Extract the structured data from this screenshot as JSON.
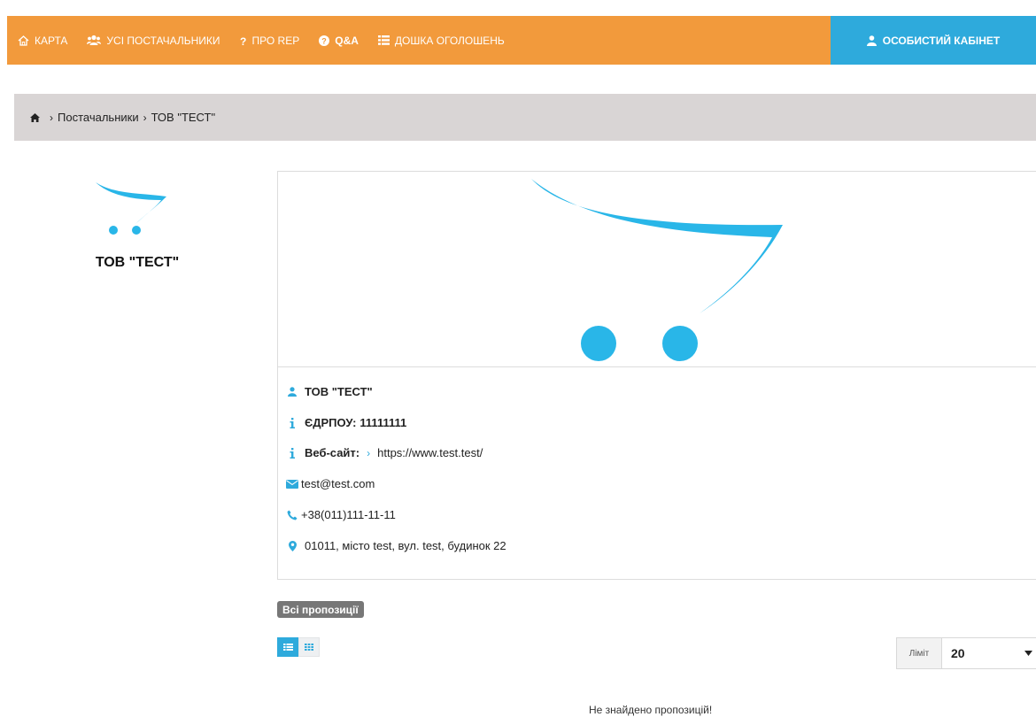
{
  "nav": {
    "items": [
      {
        "label": "Карта",
        "icon": "home-icon"
      },
      {
        "label": "Усі постачальники",
        "icon": "users-icon"
      },
      {
        "label": "Про REP",
        "icon": "question-icon"
      },
      {
        "label": "Q&A",
        "icon": "question-circle-icon"
      },
      {
        "label": "Дошка оголошень",
        "icon": "list-icon"
      }
    ],
    "cabinet_label": "Особистий кабінет"
  },
  "breadcrumb": {
    "items": [
      "Постачальники",
      "ТОВ \"ТЕСТ\""
    ]
  },
  "supplier": {
    "name": "ТОВ \"ТЕСТ\"",
    "edrpou_label": "ЄДРПОУ:",
    "edrpou": "11111111",
    "website_label": "Веб-сайт:",
    "website": "https://www.test.test/",
    "email": "test@test.com",
    "phone": "+38(011)111-11-11",
    "address": "01011, місто test, вул. test, будинок 22"
  },
  "offers": {
    "tag": "Всі пропозиції",
    "limit_label": "Ліміт",
    "limit_value": "20",
    "empty_message": "Не знайдено пропозицій!"
  },
  "colors": {
    "nav_bg": "#f29a3c",
    "accent": "#2eaadc",
    "breadcrumb_bg": "#d9d5d5"
  }
}
